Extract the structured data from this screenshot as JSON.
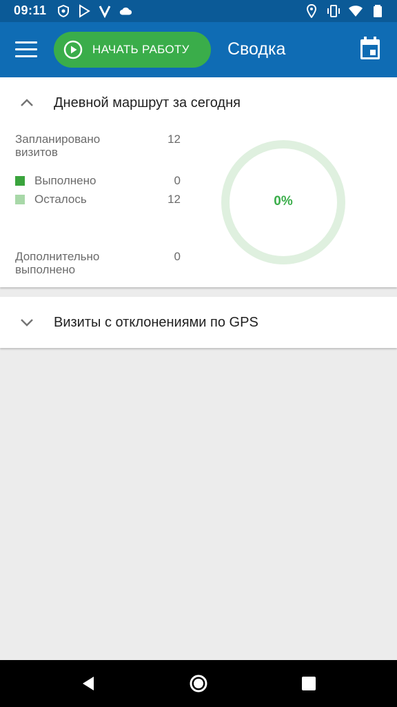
{
  "status_bar": {
    "time": "09:11"
  },
  "app_bar": {
    "start_button_label": "НАЧАТЬ РАБОТУ",
    "title": "Сводка"
  },
  "daily_route": {
    "title": "Дневной маршрут за сегодня",
    "planned_label": "Запланировано визитов",
    "planned_value": "12",
    "done_label": "Выполнено",
    "done_value": "0",
    "remaining_label": "Осталось",
    "remaining_value": "12",
    "extra_label": "Дополнительно выполнено",
    "extra_value": "0",
    "progress_text": "0%",
    "progress_fraction": 0
  },
  "gps_visits": {
    "title": "Визиты с отклонениями по GPS"
  },
  "colors": {
    "app_bar": "#0f6cb4",
    "status_bar": "#0b5a97",
    "accent_green": "#3aad4a",
    "done_legend": "#3aa43d",
    "remaining_legend": "#a8d8a8",
    "donut_track": "#dff0df"
  },
  "icons": {
    "menu": "hamburger-icon",
    "play": "play-circle-icon",
    "calendar": "calendar-icon",
    "expand": "chevron-up-icon",
    "collapse": "chevron-down-icon"
  }
}
